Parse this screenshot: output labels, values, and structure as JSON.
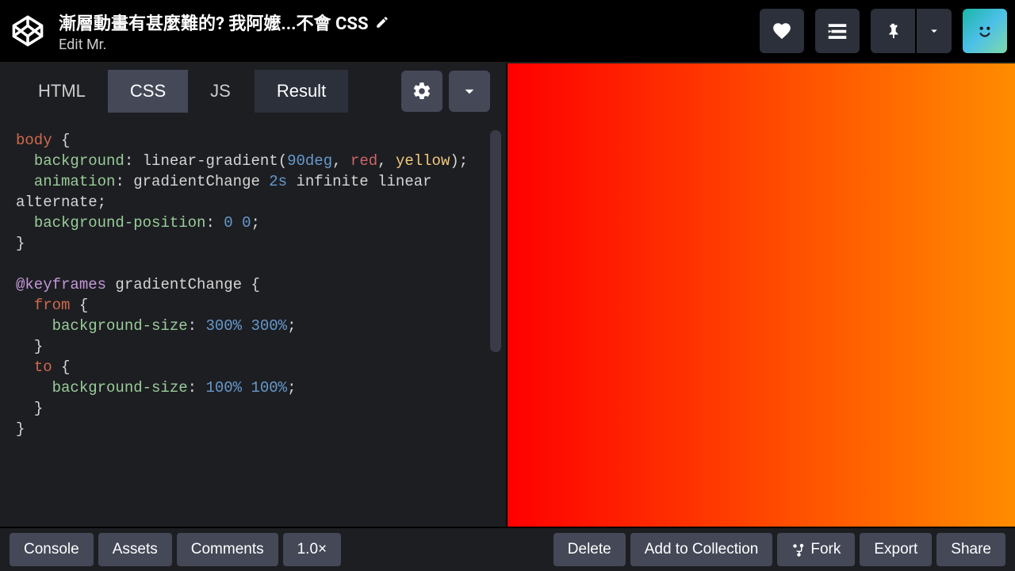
{
  "header": {
    "pen_title": "漸層動畫有甚麼難的? 我阿嬤...不會 CSS",
    "author_prefix": "Edit Mr."
  },
  "tabs": {
    "html": "HTML",
    "css": "CSS",
    "js": "JS",
    "result": "Result"
  },
  "code": {
    "line1_selector": "body",
    "line1_brace": " {",
    "line2_prop": "background",
    "line2_colon": ": ",
    "line2_func": "linear-gradient",
    "line2_open": "(",
    "line2_deg": "90deg",
    "line2_c1": ", ",
    "line2_red": "red",
    "line2_c2": ", ",
    "line2_yellow": "yellow",
    "line2_close": ");",
    "line3_prop": "animation",
    "line3_colon": ": gradientChange ",
    "line3_dur": "2s",
    "line3_rest": " infinite linear",
    "line4": "alternate;",
    "line5_prop": "background-position",
    "line5_colon": ": ",
    "line5_v1": "0",
    "line5_sp": " ",
    "line5_v2": "0",
    "line5_end": ";",
    "line6": "}",
    "line8_at": "@keyframes",
    "line8_name": " gradientChange {",
    "line9_from": "from",
    "line9_brace": " {",
    "line10_prop": "background-size",
    "line10_colon": ": ",
    "line10_v1": "300%",
    "line10_sp": " ",
    "line10_v2": "300%",
    "line10_end": ";",
    "line11": "}",
    "line12_to": "to",
    "line12_brace": " {",
    "line13_prop": "background-size",
    "line13_colon": ": ",
    "line13_v1": "100%",
    "line13_sp": " ",
    "line13_v2": "100%",
    "line13_end": ";",
    "line14": "}",
    "line15": "}"
  },
  "footer": {
    "console": "Console",
    "assets": "Assets",
    "comments": "Comments",
    "zoom": "1.0×",
    "delete": "Delete",
    "add": "Add to Collection",
    "fork": "Fork",
    "export": "Export",
    "share": "Share"
  }
}
